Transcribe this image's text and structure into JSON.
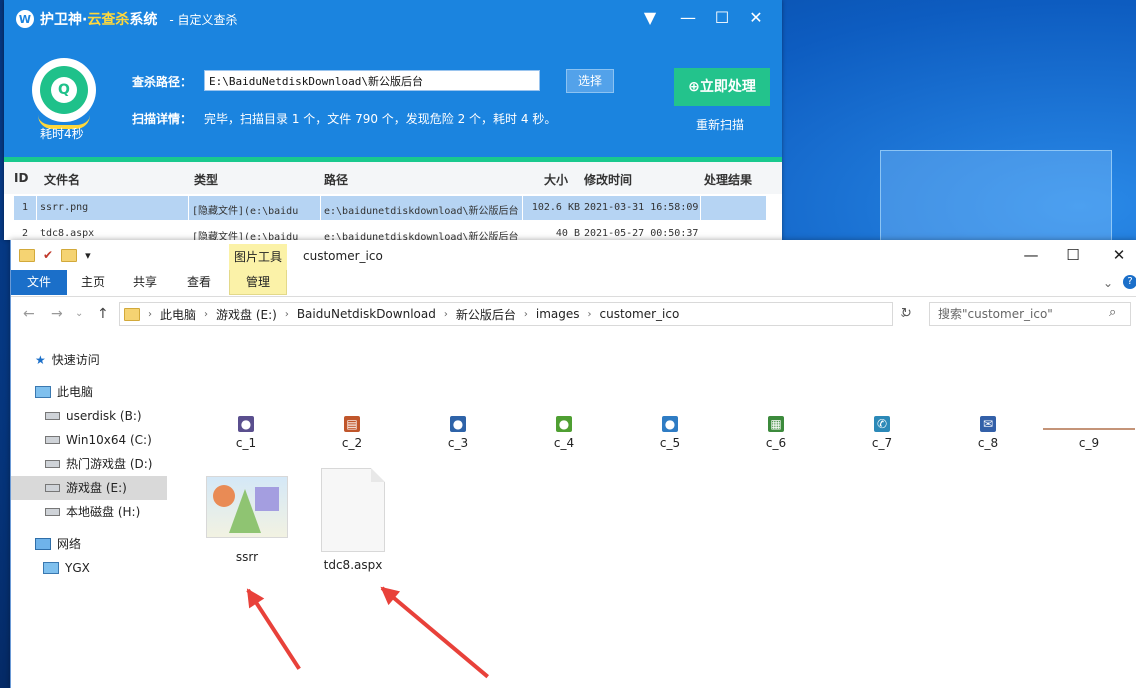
{
  "scanner": {
    "logo_glyph": "W",
    "app_name_a": "护卫神·",
    "app_name_b": "云查杀",
    "app_name_c": "系统",
    "subtitle": "- 自定义查杀",
    "win_menu": "▼",
    "win_min": "—",
    "win_max": "☐",
    "win_close": "✕",
    "badge_glyph": "Q",
    "elapsed": "耗时4秒",
    "path_label": "查杀路径：",
    "path_value": "E:\\BaiduNetdiskDownload\\新公版后台",
    "choose_label": "选择",
    "detail_label": "扫描详情：",
    "detail_value": "完毕，扫描目录 1 个，文件 790 个，发现危险 2 个，耗时 4 秒。",
    "action_label": "⊕立即处理",
    "rescan_label": "重新扫描",
    "columns": [
      "ID",
      "文件名",
      "类型",
      "路径",
      "大小",
      "修改时间",
      "处理结果"
    ],
    "rows": [
      {
        "id": "1",
        "name": "ssrr.png",
        "type": "[隐藏文件](e:\\baidu",
        "path": "e:\\baidunetdiskdownload\\新公版后台",
        "size": "102.6 KB",
        "mtime": "2021-03-31 16:58:09",
        "result": ""
      },
      {
        "id": "2",
        "name": "tdc8.aspx",
        "type": "[隐藏文件](e:\\baidu",
        "path": "e:\\baidunetdiskdownload\\新公版后台",
        "size": "40 B",
        "mtime": "2021-05-27 00:50:37",
        "result": ""
      }
    ]
  },
  "explorer": {
    "qa_check": "✔",
    "qa_dropdown": "▾",
    "context_tab": "图片工具",
    "title": "customer_ico",
    "win_min": "—",
    "win_max": "☐",
    "win_close": "✕",
    "help": "?",
    "ribbon_expand": "⌄",
    "tabs": [
      "文件",
      "主页",
      "共享",
      "查看",
      "管理"
    ],
    "nav_back": "←",
    "nav_forward": "→",
    "nav_dropdown": "⌄",
    "nav_up": "↑",
    "crumb_sep": "›",
    "breadcrumb": [
      "此电脑",
      "游戏盘 (E:)",
      "BaiduNetdiskDownload",
      "新公版后台",
      "images",
      "customer_ico"
    ],
    "addr_dropdown": "⌄",
    "refresh": "↻",
    "search_placeholder": "搜索\"customer_ico\"",
    "search_glyph": "⌕",
    "sidebar": [
      {
        "label": "快速访问",
        "glyph": "★"
      },
      {
        "label": "此电脑"
      },
      {
        "label": "userdisk (B:)"
      },
      {
        "label": "Win10x64 (C:)"
      },
      {
        "label": "热门游戏盘 (D:)"
      },
      {
        "label": "游戏盘 (E:)"
      },
      {
        "label": "本地磁盘 (H:)"
      },
      {
        "label": "网络"
      },
      {
        "label": "YGX"
      }
    ],
    "small_icons": [
      {
        "label": "c_1",
        "glyph": "●",
        "color": "#5a4f8e"
      },
      {
        "label": "c_2",
        "glyph": "▤",
        "color": "#c0562b"
      },
      {
        "label": "c_3",
        "glyph": "●",
        "color": "#2e63a8"
      },
      {
        "label": "c_4",
        "glyph": "●",
        "color": "#4f9f32"
      },
      {
        "label": "c_5",
        "glyph": "●",
        "color": "#2f7cc4"
      },
      {
        "label": "c_6",
        "glyph": "▦",
        "color": "#3c8a3c"
      },
      {
        "label": "c_7",
        "glyph": "✆",
        "color": "#2b89b8"
      },
      {
        "label": "c_8",
        "glyph": "✉",
        "color": "#3360a8"
      },
      {
        "label": "c_9",
        "glyph": "",
        "color": "#c49478"
      }
    ],
    "big_icons": [
      {
        "label": "ssrr"
      },
      {
        "label": "tdc8.aspx"
      }
    ]
  },
  "colors": {
    "scanner_blue": "#1b84df",
    "scanner_green": "#23c38c",
    "explorer_accent": "#1b6fc9",
    "arrow_red": "#e8413a"
  }
}
